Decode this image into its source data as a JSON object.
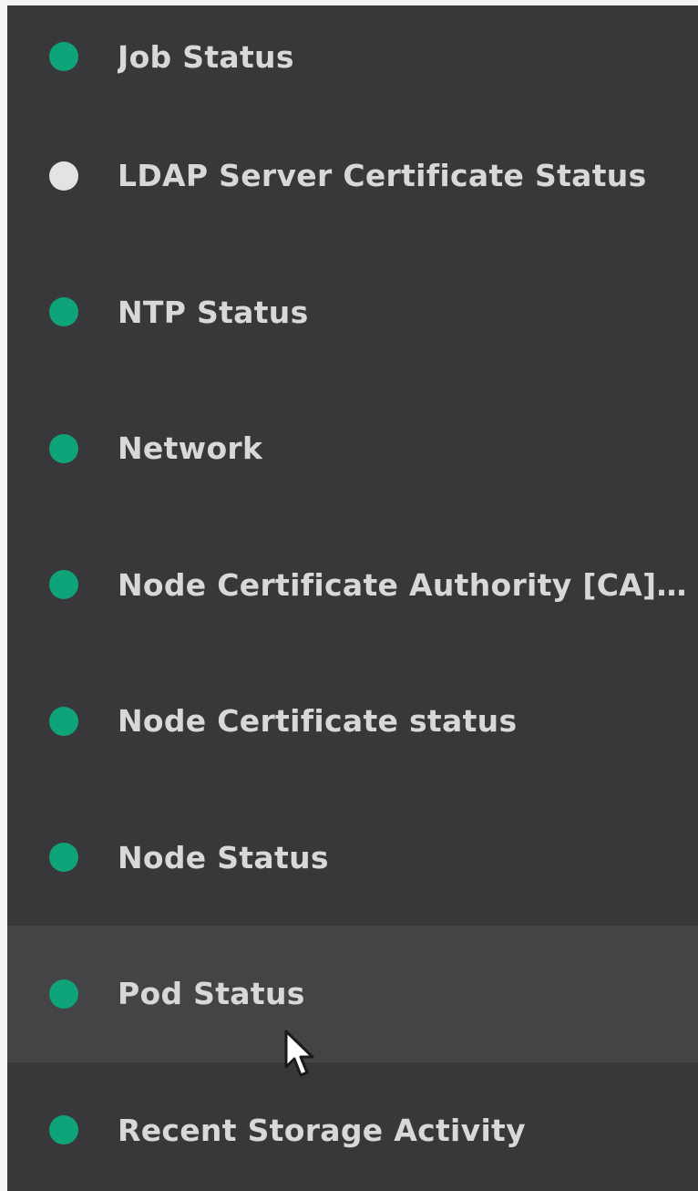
{
  "colors": {
    "background": "#38383a",
    "row_hover": "#444446",
    "label": "#d8d8d8",
    "status_ok": "#0fa37a",
    "status_unknown": "#e3e3e3"
  },
  "status_items": [
    {
      "label": "Job Status",
      "status": "ok",
      "color": "#0fa37a"
    },
    {
      "label": "LDAP Server Certificate Status",
      "status": "unknown",
      "color": "#e3e3e3"
    },
    {
      "label": "NTP Status",
      "status": "ok",
      "color": "#0fa37a"
    },
    {
      "label": "Network",
      "status": "ok",
      "color": "#0fa37a"
    },
    {
      "label": "Node Certificate Authority [CA] …",
      "status": "ok",
      "color": "#0fa37a"
    },
    {
      "label": "Node Certificate status",
      "status": "ok",
      "color": "#0fa37a"
    },
    {
      "label": "Node Status",
      "status": "ok",
      "color": "#0fa37a"
    },
    {
      "label": "Pod Status",
      "status": "ok",
      "color": "#0fa37a",
      "hovered": true
    },
    {
      "label": "Recent Storage Activity",
      "status": "ok",
      "color": "#0fa37a"
    }
  ],
  "cursor": {
    "icon": "mouse-pointer-icon"
  }
}
